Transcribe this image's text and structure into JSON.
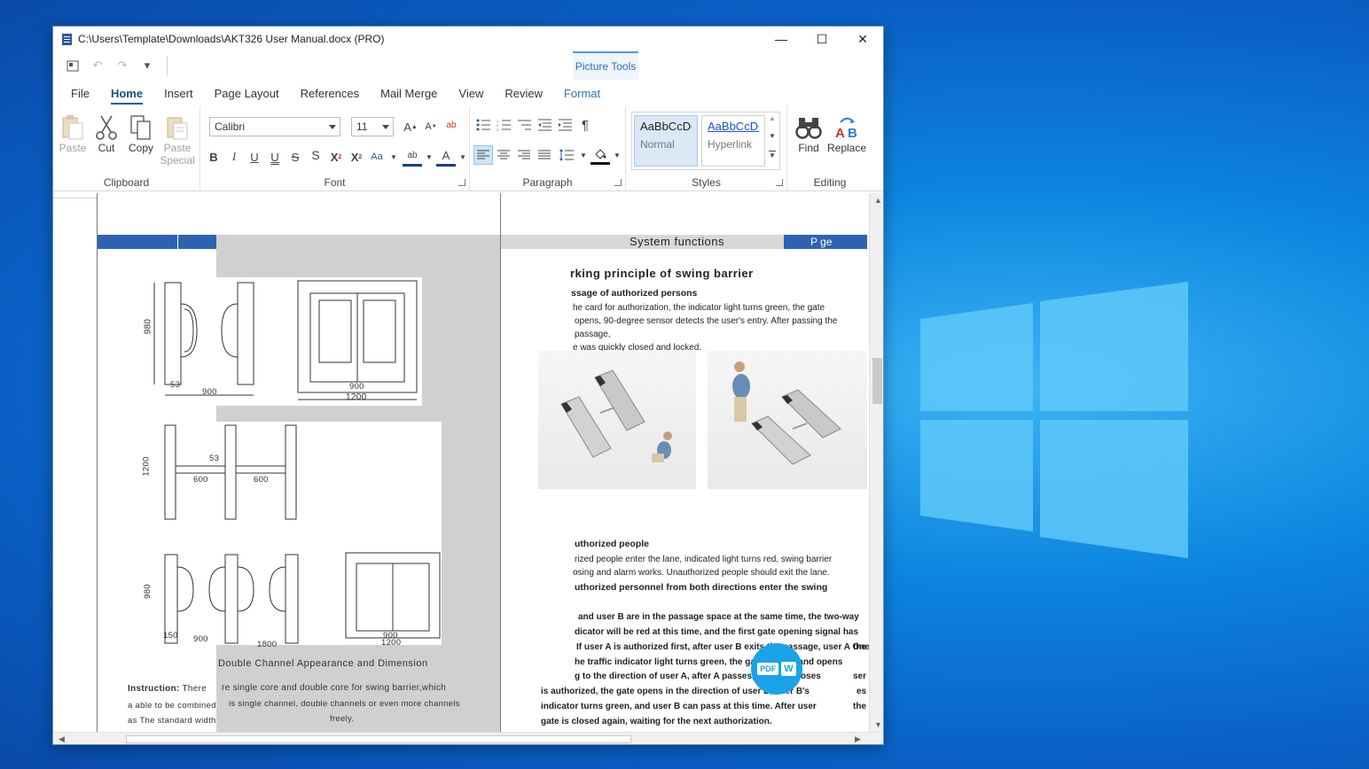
{
  "window": {
    "title": "C:\\Users\\Template\\Downloads\\AKT326 User Manual.docx (PRO)",
    "minimize_glyph": "—",
    "maximize_glyph": "☐",
    "close_glyph": "✕"
  },
  "qat": {
    "picture_tools": "Picture Tools"
  },
  "tabs": [
    "File",
    "Home",
    "Insert",
    "Page Layout",
    "References",
    "Mail Merge",
    "View",
    "Review",
    "Format"
  ],
  "ribbon": {
    "clipboard": {
      "label": "Clipboard",
      "paste": "Paste",
      "cut": "Cut",
      "copy": "Copy",
      "paste_special_1": "Paste",
      "paste_special_2": "Special"
    },
    "font": {
      "label": "Font",
      "font_name": "Calibri",
      "font_size": "11"
    },
    "paragraph": {
      "label": "Paragraph"
    },
    "styles": {
      "label": "Styles",
      "items": [
        {
          "sample": "AaBbCcDd",
          "name": "Normal"
        },
        {
          "sample": "AaBbCcDd",
          "name": "Hyperlink"
        }
      ]
    },
    "editing": {
      "label": "Editing",
      "find": "Find",
      "replace": "Replace"
    }
  },
  "document": {
    "header_right_title": "System functions",
    "header_page": "P  ge",
    "dims": {
      "d1": "980",
      "d2": "53",
      "d3": "900",
      "d4": "900",
      "d5": "1200",
      "d6": "1200",
      "d7": "53",
      "d8": "600",
      "d9": "600",
      "d10": "980",
      "d11": "150",
      "d12": "900",
      "d13": "1800",
      "d14": "900",
      "d15": "1200"
    },
    "left_caption": "Double Channel Appearance and Dimension",
    "instruction_label": "Instruction:",
    "instruction_start": "There",
    "instruction_line2_start": "a able to be combined",
    "instruction_line3_start": "as The  standard width",
    "overlay_text_1": "re single core  and double core for swing barrier,which",
    "overlay_text_2": "is single channel, double channels or even  more channels",
    "overlay_text_3": "freely.",
    "right": {
      "heading": "rking principle of swing barrier",
      "sub1": "ssage of authorized persons",
      "p1_l1": "he card for authorization, the indicator light turns green, the gate",
      "p1_l2": "opens, 90-degree sensor detects the user's entry. After passing the",
      "p1_l3": "passage,",
      "p1_l4": "e was quickly closed and locked.",
      "sub2": "uthorized people",
      "p2_l1": "rized people enter the lane, indicated light turns red, swing barrier",
      "p2_l2": "osing and alarm works. Unauthorized people should exit the lane.",
      "sub3": "uthorized personnel from both directions enter the swing",
      "b_l1": "and user B are in the passage space at the same time, the two-way",
      "b_l2": "dicator will be red at this time, and the first gate opening signal has",
      "b_l3": "If user A is authorized first, after user B exits the passage, user A One",
      "b_l4": "he traffic indicator light turns green, the gate swings and opens",
      "b_l5": "g to the direction of user A, after A passes, the gate closes",
      "b_l6": "is authorized, the gate opens in the direction of user B, user B's",
      "b_l7": "indicator turns green, and user B can pass at this time. After user",
      "b_l8": "gate is closed again, waiting for the next authorization.",
      "b_tail1": "ser",
      "b_tail2": "es",
      "b_tail3": "the",
      "b_tail4": "the"
    },
    "badge_pdf": "PDF",
    "badge_w": "W"
  }
}
